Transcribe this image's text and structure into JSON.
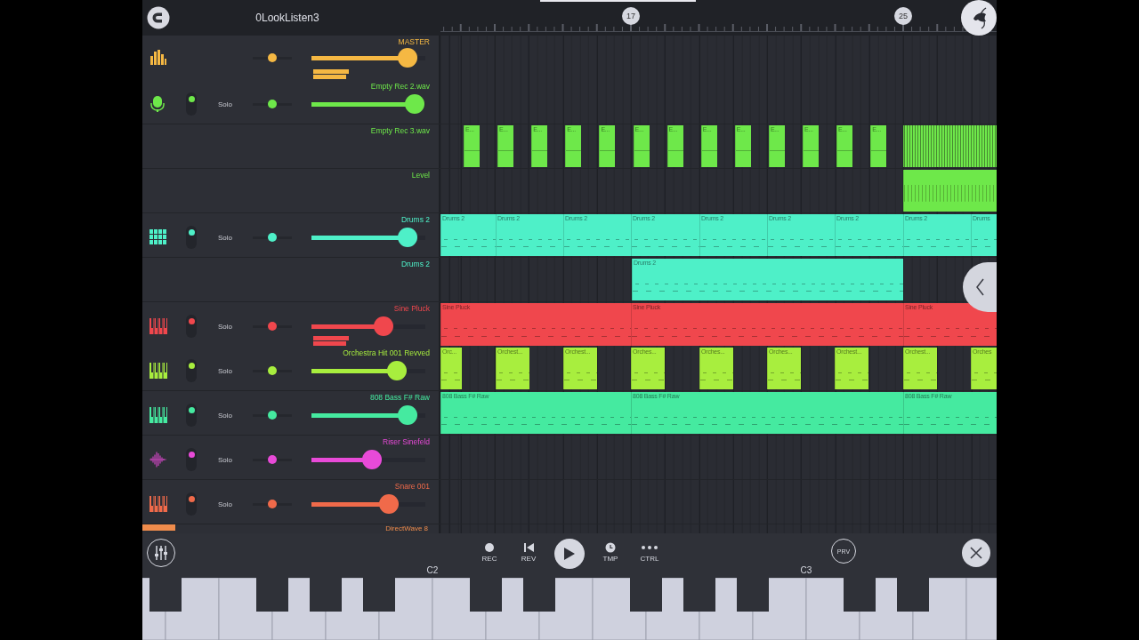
{
  "topbar": {
    "title": "0LookListen3",
    "markers": [
      "17",
      "25"
    ]
  },
  "tracks": [
    {
      "kind": "master",
      "name": "MASTER",
      "color": "#f5b843",
      "pan": {
        "level": 0.5
      },
      "volume": {
        "level": 0.84
      },
      "meter": true
    },
    {
      "kind": "audio",
      "name": "Empty Rec 2.wav",
      "color": "#6ee84a",
      "enabled": true,
      "solo_label": "Solo",
      "pan": {
        "level": 0.5
      },
      "volume": {
        "level": 0.91
      }
    },
    {
      "kind": "cliplane",
      "name": "Empty Rec 3.wav",
      "color": "#6ee84a",
      "clips": [
        {
          "kind": "audio",
          "label": "E..."
        },
        {
          "kind": "audio",
          "label": "E..."
        },
        {
          "kind": "audio",
          "label": "E..."
        },
        {
          "kind": "audio",
          "label": "E..."
        },
        {
          "kind": "audio",
          "label": "E..."
        },
        {
          "kind": "audio",
          "label": "E..."
        },
        {
          "kind": "audio",
          "label": "E..."
        },
        {
          "kind": "audio",
          "label": "E..."
        },
        {
          "kind": "audio",
          "label": "E..."
        },
        {
          "kind": "audio",
          "label": "E..."
        },
        {
          "kind": "audio",
          "label": "E..."
        },
        {
          "kind": "audio",
          "label": "E..."
        },
        {
          "kind": "audio",
          "label": "E..."
        },
        {
          "kind": "dense"
        }
      ]
    },
    {
      "kind": "automation",
      "name": "Level",
      "color": "#6ee84a",
      "clips": [
        {
          "kind": "automation"
        }
      ]
    },
    {
      "kind": "drums",
      "name": "Drums 2",
      "color": "#4ef0c8",
      "enabled": true,
      "solo_label": "Solo",
      "pan": {
        "level": 0.5
      },
      "volume": {
        "level": 0.84
      },
      "clips": [
        {
          "kind": "pattern",
          "label": "Drums 2"
        },
        {
          "kind": "pattern",
          "label": "Drums 2"
        },
        {
          "kind": "pattern",
          "label": "Drums 2"
        },
        {
          "kind": "pattern",
          "label": "Drums 2"
        },
        {
          "kind": "pattern",
          "label": "Drums 2"
        },
        {
          "kind": "pattern",
          "label": "Drums 2"
        },
        {
          "kind": "pattern",
          "label": "Drums 2"
        },
        {
          "kind": "pattern",
          "label": "Drums 2"
        },
        {
          "kind": "pattern",
          "label": "Drums"
        }
      ]
    },
    {
      "kind": "cliplane",
      "name": "Drums 2",
      "color": "#4ef0c8",
      "clips": [
        {
          "kind": "pattern",
          "label": "Drums 2"
        }
      ]
    },
    {
      "kind": "keys",
      "name": "Sine Pluck",
      "color": "#f0474d",
      "enabled": true,
      "solo_label": "Solo",
      "pan": {
        "level": 0.5
      },
      "volume": {
        "level": 0.63
      },
      "meter": true,
      "clips": [
        {
          "kind": "pattern",
          "label": "Sine Pluck"
        },
        {
          "kind": "pattern",
          "label": "Sine Pluck"
        },
        {
          "kind": "pattern",
          "label": "Sine Pluck"
        }
      ]
    },
    {
      "kind": "keys",
      "name": "Orchestra Hit 001 Revved",
      "color": "#a8ee3e",
      "enabled": true,
      "solo_label": "Solo",
      "pan": {
        "level": 0.5
      },
      "volume": {
        "level": 0.75
      },
      "clips": [
        {
          "kind": "pattern",
          "label": "Orc..."
        },
        {
          "kind": "pattern",
          "label": "Orchest..."
        },
        {
          "kind": "pattern",
          "label": "Orchest..."
        },
        {
          "kind": "pattern",
          "label": "Orches..."
        },
        {
          "kind": "pattern",
          "label": "Orches..."
        },
        {
          "kind": "pattern",
          "label": "Orches..."
        },
        {
          "kind": "pattern",
          "label": "Orchest..."
        },
        {
          "kind": "pattern",
          "label": "Orchest..."
        },
        {
          "kind": "pattern",
          "label": "Orches"
        }
      ]
    },
    {
      "kind": "keys",
      "name": "808 Bass F# Raw",
      "color": "#45eaa0",
      "enabled": true,
      "solo_label": "Solo",
      "pan": {
        "level": 0.5
      },
      "volume": {
        "level": 0.84
      },
      "clips": [
        {
          "kind": "pattern",
          "label": "808 Bass F# Raw"
        },
        {
          "kind": "pattern",
          "label": "808 Bass F# Raw"
        },
        {
          "kind": "pattern",
          "label": "808 Bass F# Raw"
        }
      ]
    },
    {
      "kind": "sampler",
      "name": "Riser Sinefeld",
      "color": "#e84ad8",
      "enabled": true,
      "solo_label": "Solo",
      "pan": {
        "level": 0.5
      },
      "volume": {
        "level": 0.53
      }
    },
    {
      "kind": "keys",
      "name": "Snare 001",
      "color": "#f06a4a",
      "enabled": true,
      "solo_label": "Solo",
      "pan": {
        "level": 0.5
      },
      "volume": {
        "level": 0.68
      }
    }
  ],
  "partial_track": {
    "name": "DirectWave 8",
    "color": "#f08c4c"
  },
  "transport": {
    "buttons": [
      {
        "kind": "rec",
        "label": "REC"
      },
      {
        "kind": "rev",
        "label": "REV"
      },
      {
        "kind": "play"
      },
      {
        "kind": "tmp",
        "label": "TMP"
      },
      {
        "kind": "ctrl",
        "label": "CTRL"
      }
    ],
    "preview": "PRV"
  },
  "keyboard": {
    "octave_labels": [
      "C2",
      "C3"
    ]
  }
}
